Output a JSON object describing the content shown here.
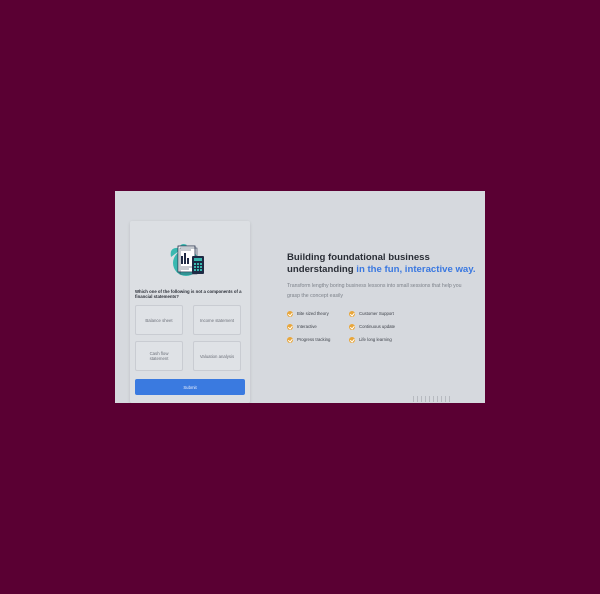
{
  "quiz": {
    "question": "Which one of the following is not a components of a financial statements?",
    "options": [
      {
        "label": "Balance sheet"
      },
      {
        "label": "Income statement"
      },
      {
        "label": "Cash flow statement"
      },
      {
        "label": "Valuation analysis"
      }
    ],
    "submit_label": "Submit",
    "illustration_icon": "calculator-document-icon"
  },
  "hero": {
    "headline_part1": "Building foundational business understanding ",
    "headline_accent": "in the fun, interactive way.",
    "subtitle": "Transform lengthy boring business lessons into small sessions that help you grasp the concept easily"
  },
  "features": [
    {
      "label": "Bite sized theory"
    },
    {
      "label": "Customer Support"
    },
    {
      "label": "Interactive"
    },
    {
      "label": "Continuous update"
    },
    {
      "label": "Progress tracking"
    },
    {
      "label": "Life long learning"
    }
  ],
  "colors": {
    "background": "#5a0033",
    "panel": "#d6d9de",
    "accent": "#3a78e0",
    "check": "#e8a63a"
  }
}
